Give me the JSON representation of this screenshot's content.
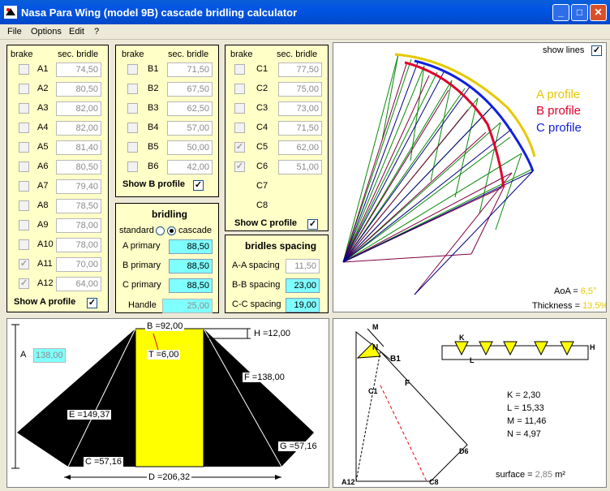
{
  "window": {
    "title": "Nasa Para Wing (model 9B) cascade bridling calculator",
    "minimize": "_",
    "maximize": "□",
    "close": "✕"
  },
  "menu": [
    "File",
    "Options",
    "Edit",
    "?"
  ],
  "col_headers": {
    "brake": "brake",
    "sec_bridle": "sec. bridle"
  },
  "a_rows": [
    {
      "label": "A1",
      "value": "74,50",
      "brake": false
    },
    {
      "label": "A2",
      "value": "80,50",
      "brake": false
    },
    {
      "label": "A3",
      "value": "82,00",
      "brake": false
    },
    {
      "label": "A4",
      "value": "82,00",
      "brake": false
    },
    {
      "label": "A5",
      "value": "81,40",
      "brake": false
    },
    {
      "label": "A6",
      "value": "80,50",
      "brake": false
    },
    {
      "label": "A7",
      "value": "79,40",
      "brake": false
    },
    {
      "label": "A8",
      "value": "78,50",
      "brake": false
    },
    {
      "label": "A9",
      "value": "78,00",
      "brake": false
    },
    {
      "label": "A10",
      "value": "78,00",
      "brake": false
    },
    {
      "label": "A11",
      "value": "70,00",
      "brake": true
    },
    {
      "label": "A12",
      "value": "64,00",
      "brake": true
    }
  ],
  "b_rows": [
    {
      "label": "B1",
      "value": "71,50",
      "brake": false
    },
    {
      "label": "B2",
      "value": "67,50",
      "brake": false
    },
    {
      "label": "B3",
      "value": "62,50",
      "brake": false
    },
    {
      "label": "B4",
      "value": "57,00",
      "brake": false
    },
    {
      "label": "B5",
      "value": "50,00",
      "brake": false
    },
    {
      "label": "B6",
      "value": "42,00",
      "brake": false
    }
  ],
  "c_rows": [
    {
      "label": "C1",
      "value": "77,50",
      "brake": false
    },
    {
      "label": "C2",
      "value": "75,00",
      "brake": false
    },
    {
      "label": "C3",
      "value": "73,00",
      "brake": false
    },
    {
      "label": "C4",
      "value": "71,50",
      "brake": false
    },
    {
      "label": "C5",
      "value": "62,00",
      "brake": true
    },
    {
      "label": "C6",
      "value": "51,00",
      "brake": true
    }
  ],
  "c_extra": [
    "C7",
    "C8"
  ],
  "show_a": "Show A profile",
  "show_b": "Show B profile",
  "show_c": "Show C profile",
  "check_mark": "✓",
  "bridling": {
    "title": "bridling",
    "standard": "standard",
    "cascade": "cascade",
    "a_primary_label": "A primary",
    "a_primary": "88,50",
    "b_primary_label": "B primary",
    "b_primary": "88,50",
    "c_primary_label": "C primary",
    "c_primary": "88,50",
    "handle_label": "Handle",
    "handle": "25,00"
  },
  "spacing": {
    "title": "bridles spacing",
    "aa_label": "A-A spacing",
    "aa": "11,50",
    "bb_label": "B-B spacing",
    "bb": "23,00",
    "cc_label": "C-C spacing",
    "cc": "19,00"
  },
  "profile_view": {
    "show_lines": "show lines",
    "a_label": "A profile",
    "b_label": "B profile",
    "c_label": "C profile",
    "a_color": "#e6c800",
    "b_color": "#e0002a",
    "c_color": "#1020e0",
    "aoa_label": "AoA =",
    "aoa": "6,5°",
    "thickness_label": "Thickness =",
    "thickness": "13,5%"
  },
  "wing_view": {
    "A_label": "A",
    "A_value": "138,00",
    "B": "B =92,00",
    "T": "T =6,00",
    "H": "H =12,00",
    "F": "F =138,00",
    "E": "E =149,37",
    "C": "C =57,16",
    "G": "G =57,16",
    "D": "D =206,32"
  },
  "bridle_view": {
    "M": "M",
    "N": "N",
    "B1": "B1",
    "F": "F",
    "C1": "C1",
    "D6": "D6",
    "A12": "A12",
    "C8": "C8",
    "K_letter": "K",
    "L_letter": "L",
    "H_letter": "H",
    "K": "K = 2,30",
    "L": "L = 15,33",
    "Mv": "M = 11,46",
    "Nv": "N = 4,97",
    "surface_label": "surface =",
    "surface": "2,85",
    "unit": "m²"
  }
}
